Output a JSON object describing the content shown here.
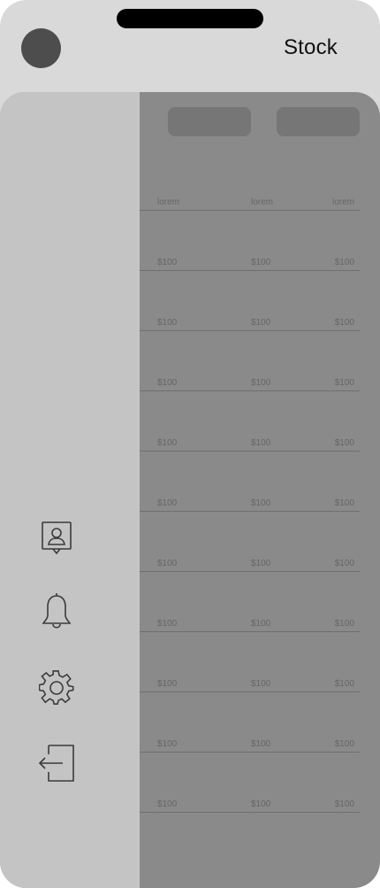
{
  "header": {
    "title": "Stock"
  },
  "table": {
    "columns": [
      "lorem",
      "lorem",
      "lorem"
    ],
    "rows": [
      [
        "$100",
        "$100",
        "$100"
      ],
      [
        "$100",
        "$100",
        "$100"
      ],
      [
        "$100",
        "$100",
        "$100"
      ],
      [
        "$100",
        "$100",
        "$100"
      ],
      [
        "$100",
        "$100",
        "$100"
      ],
      [
        "$100",
        "$100",
        "$100"
      ],
      [
        "$100",
        "$100",
        "$100"
      ],
      [
        "$100",
        "$100",
        "$100"
      ],
      [
        "$100",
        "$100",
        "$100"
      ],
      [
        "$100",
        "$100",
        "$100"
      ]
    ]
  },
  "drawer": {
    "items": [
      {
        "icon": "contact-icon"
      },
      {
        "icon": "bell-icon"
      },
      {
        "icon": "gear-icon"
      },
      {
        "icon": "logout-icon"
      }
    ]
  },
  "colors": {
    "header_bg": "#d9d9d9",
    "content_bg": "#8a8a8a",
    "drawer_bg": "#c4c4c4",
    "button_bg": "#767676",
    "avatar": "#4d4d4d"
  }
}
